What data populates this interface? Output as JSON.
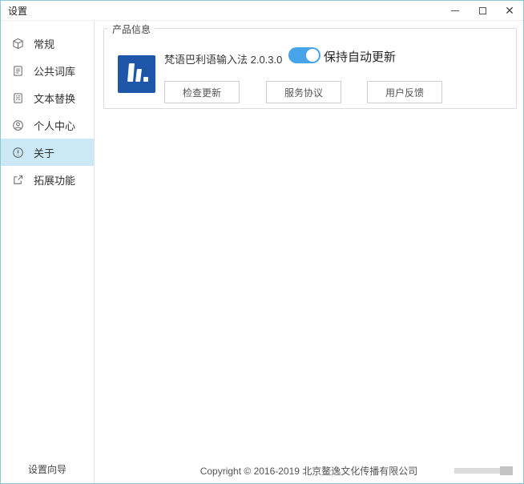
{
  "window": {
    "title": "设置",
    "controls": {
      "minimize_icon": "minimize-icon",
      "maximize_icon": "maximize-icon",
      "close_icon": "close-icon",
      "close_glyph": "✕"
    }
  },
  "sidebar": {
    "items": [
      {
        "label": "常规",
        "icon": "cube-icon",
        "selected": false
      },
      {
        "label": "公共词库",
        "icon": "dictionary-icon",
        "selected": false
      },
      {
        "label": "文本替换",
        "icon": "text-replace-icon",
        "selected": false
      },
      {
        "label": "个人中心",
        "icon": "user-icon",
        "selected": false
      },
      {
        "label": "关于",
        "icon": "info-icon",
        "selected": true
      },
      {
        "label": "拓展功能",
        "icon": "external-link-icon",
        "selected": false
      }
    ],
    "footer_label": "设置向导"
  },
  "main": {
    "group_title": "产品信息",
    "product": {
      "name": "梵语巴利语输入法 2.0.3.0",
      "logo": "brand-logo-h-dot"
    },
    "auto_update_toggle": {
      "label": "保持自动更新",
      "state": "on"
    },
    "buttons": [
      {
        "label": "检查更新"
      },
      {
        "label": "服务协议"
      },
      {
        "label": "用户反馈"
      }
    ]
  },
  "footer": {
    "copyright": "Copyright © 2016-2019 北京鳌逸文化传播有限公司"
  },
  "colors": {
    "accent_toggle": "#47a4e8",
    "logo_blue": "#1e57a9",
    "selected_item_bg": "#cbe8f6",
    "window_border": "#8cc7d6"
  }
}
